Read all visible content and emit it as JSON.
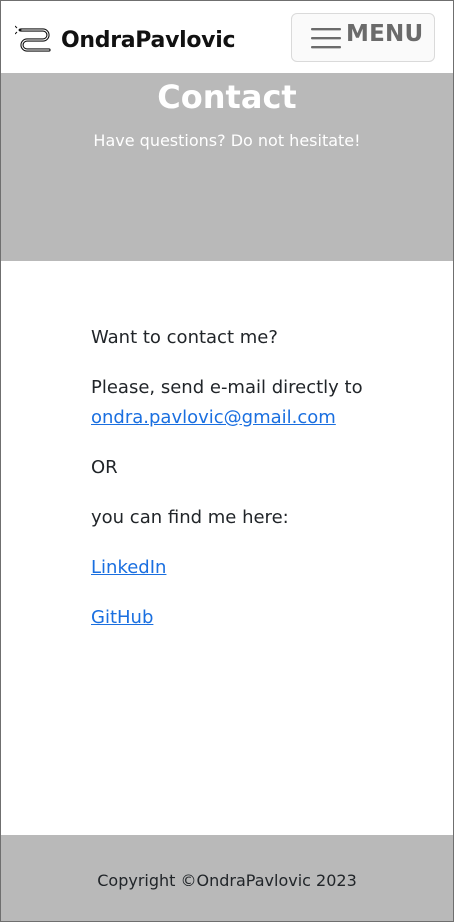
{
  "navbar": {
    "brand": "OndraPavlovic",
    "brand_icon": "snake-logo-icon",
    "menu_label": "MENU",
    "menu_icon": "hamburger-icon"
  },
  "hero": {
    "title": "Contact",
    "subtitle": "Have questions? Do not hesitate!"
  },
  "content": {
    "intro": "Want to contact me?",
    "email_prompt": "Please, send e-mail directly to",
    "email_link": "ondra.pavlovic@gmail.com",
    "or_text": "OR",
    "find_me": "you can find me here:",
    "links": [
      {
        "label": "LinkedIn"
      },
      {
        "label": "GitHub"
      }
    ]
  },
  "footer": {
    "copyright": "Copyright ©OndraPavlovic 2023"
  },
  "colors": {
    "hero_bg": "#b9b9b9",
    "link": "#1a6fe0",
    "text": "#212529"
  }
}
